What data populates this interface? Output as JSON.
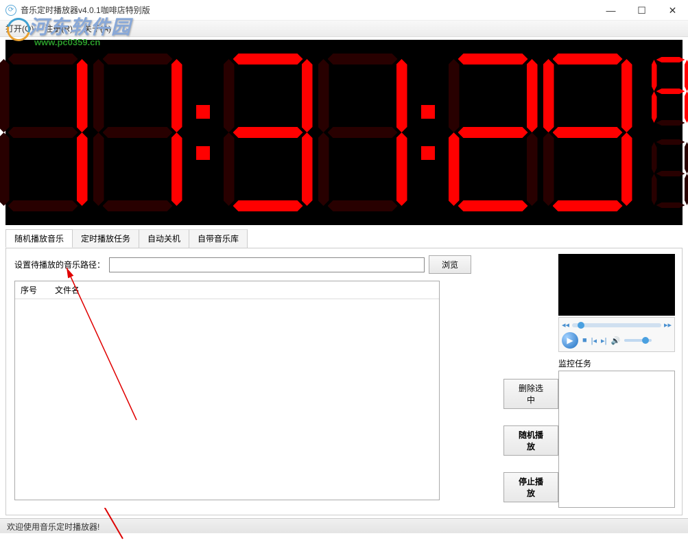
{
  "window": {
    "title": "音乐定时播放器v4.0.1咖啡店特别版"
  },
  "menu": {
    "open": "打开(O)",
    "register": "注册(R)",
    "about": "关于(A)"
  },
  "watermark": {
    "text": "河东软件园",
    "url": "www.pc0359.cn"
  },
  "clock": {
    "time": "11:31:29",
    "ampm": "A"
  },
  "tabs": [
    {
      "label": "随机播放音乐",
      "active": true
    },
    {
      "label": "定时播放任务",
      "active": false
    },
    {
      "label": "自动关机",
      "active": false
    },
    {
      "label": "自带音乐库",
      "active": false
    }
  ],
  "path": {
    "label": "设置待播放的音乐路径：",
    "value": "",
    "browse": "浏览"
  },
  "filelist": {
    "col_num": "序号",
    "col_name": "文件名"
  },
  "buttons": {
    "delete_selected": "删除选中",
    "random_play": "随机播放",
    "stop_play": "停止播放"
  },
  "monitor": {
    "label": "监控任务"
  },
  "status": "欢迎使用音乐定时播放器!"
}
